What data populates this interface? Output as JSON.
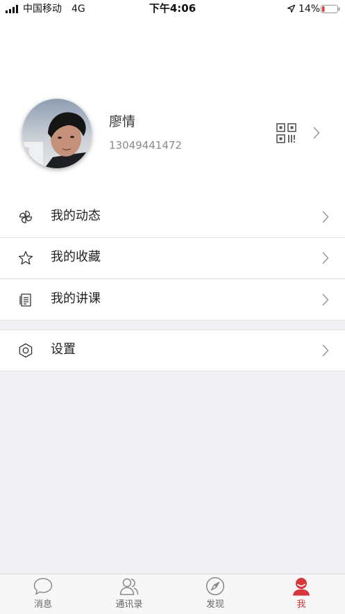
{
  "status_bar": {
    "carrier": "中国移动",
    "network": "4G",
    "time": "下午4:06",
    "battery": "14%"
  },
  "profile": {
    "name": "廖情",
    "phone": "13049441472"
  },
  "menu": [
    {
      "label": "我的动态",
      "icon": "pinwheel-icon"
    },
    {
      "label": "我的收藏",
      "icon": "star-icon"
    },
    {
      "label": "我的讲课",
      "icon": "document-icon"
    }
  ],
  "settings": {
    "label": "设置",
    "icon": "settings-hexagon-icon"
  },
  "tab_bar": {
    "items": [
      {
        "label": "消息",
        "icon": "chat-bubble-icon",
        "active": false
      },
      {
        "label": "通讯录",
        "icon": "contacts-icon",
        "active": false
      },
      {
        "label": "发现",
        "icon": "compass-icon",
        "active": false
      },
      {
        "label": "我",
        "icon": "user-icon",
        "active": true
      }
    ]
  },
  "colors": {
    "accent": "#d6363c",
    "battery_low": "#e0393e",
    "background": "#efeff4"
  }
}
